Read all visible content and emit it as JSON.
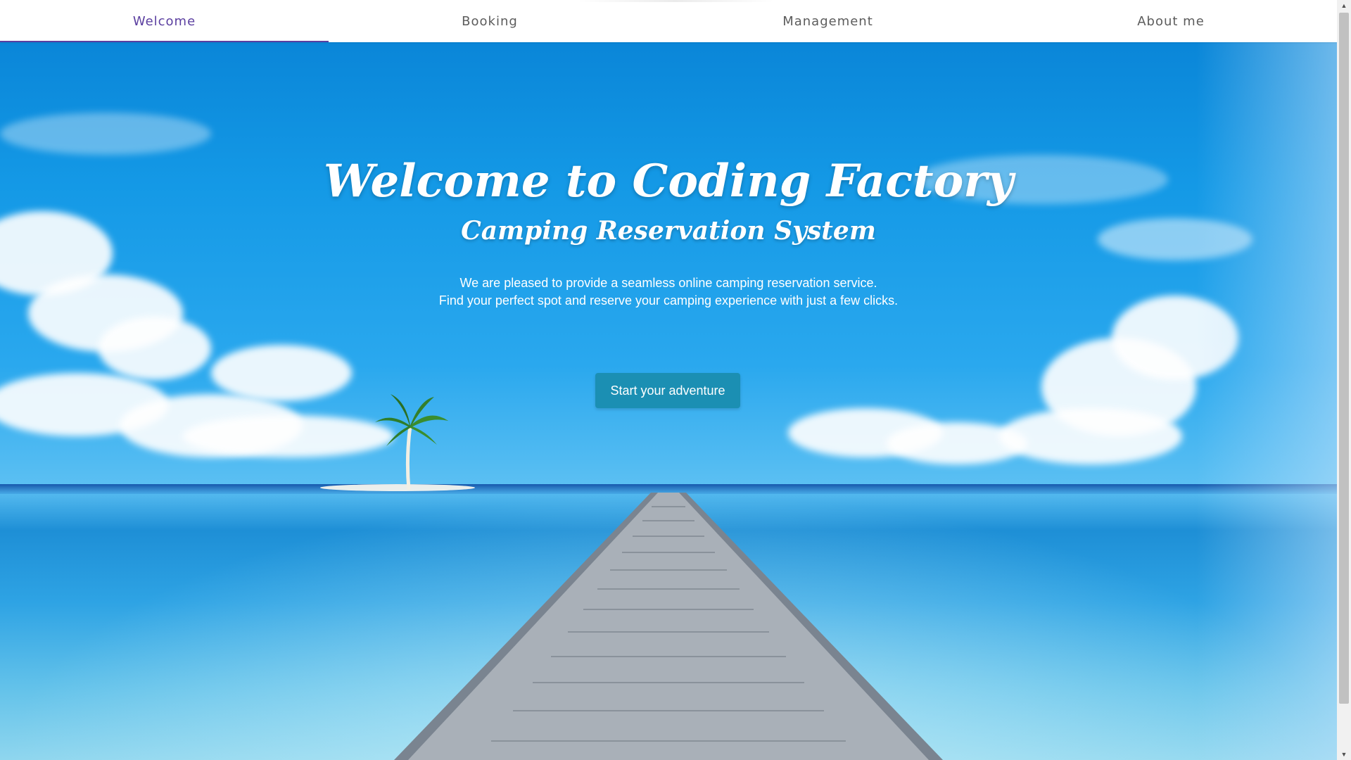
{
  "nav": {
    "tabs": [
      {
        "label": "Welcome",
        "active": true
      },
      {
        "label": "Booking",
        "active": false
      },
      {
        "label": "Management",
        "active": false
      },
      {
        "label": "About me",
        "active": false
      }
    ]
  },
  "hero": {
    "title": "Welcome to Coding Factory",
    "subtitle": "Camping Reservation System",
    "intro_line1": "We are pleased to provide a seamless online camping reservation service.",
    "intro_line2": "Find your perfect spot and reserve your camping experience with just a few clicks.",
    "cta_label": "Start your adventure"
  },
  "icons": {
    "scroll_up": "scroll-up-arrow-icon",
    "scroll_down": "scroll-down-arrow-icon"
  },
  "colors": {
    "accent": "#5b3fa0",
    "cta": "#1b8fb3",
    "sky": "#0a86d8"
  }
}
